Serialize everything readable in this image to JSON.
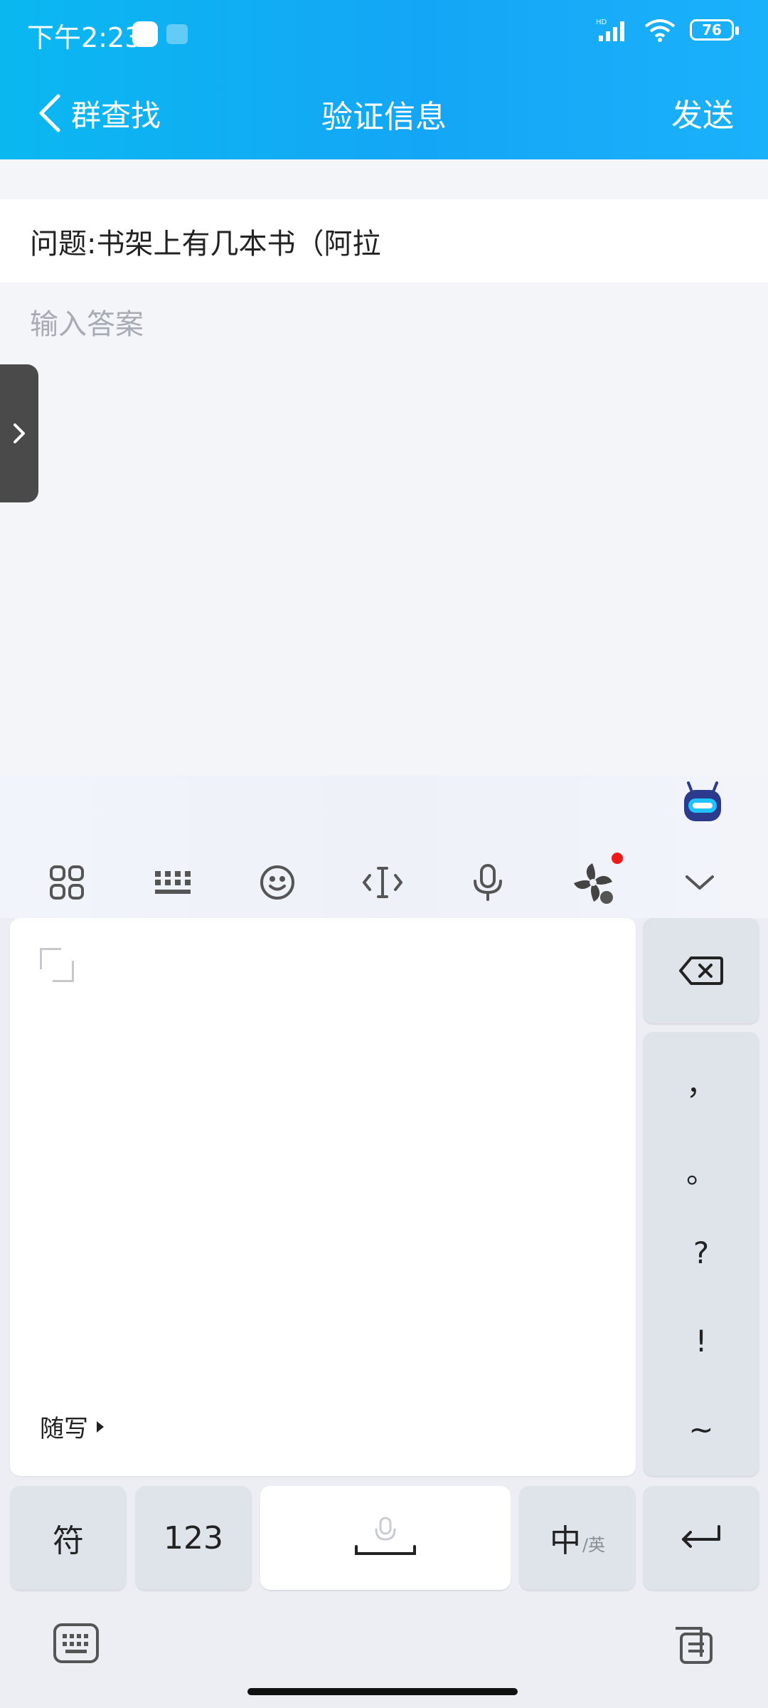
{
  "status_bar": {
    "time": "下午2:23",
    "hd_label": "HD",
    "battery": "76"
  },
  "nav": {
    "back_label": "群查找",
    "title": "验证信息",
    "send_label": "发送"
  },
  "content": {
    "question": "问题:书架上有几本书（阿拉",
    "answer_placeholder": "输入答案",
    "answer_value": ""
  },
  "keyboard": {
    "toolbar_icons": [
      "apps-grid-icon",
      "keyboard-icon",
      "emoji-icon",
      "cursor-icon",
      "microphone-icon",
      "fan-ad-icon",
      "collapse-chevron-icon"
    ],
    "freewrite_label": "随写",
    "punctuation": [
      "，",
      "。",
      "?",
      "!",
      "~"
    ],
    "keys": {
      "symbols": "符",
      "numbers": "123",
      "lang_main": "中",
      "lang_sub": "/英"
    }
  }
}
